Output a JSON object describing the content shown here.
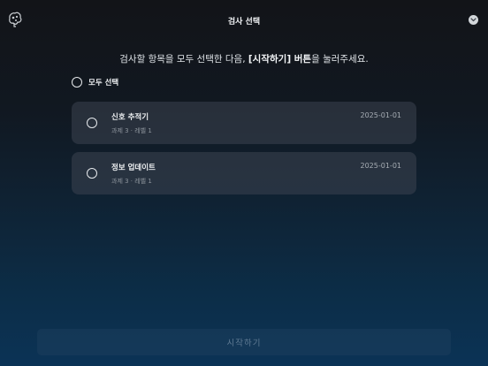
{
  "header": {
    "title": "검사 선택"
  },
  "instruction": {
    "prefix": "검사할 항목을 모두 선택한 다음, ",
    "highlight": "[시작하기] 버튼",
    "suffix": "을 눌러주세요."
  },
  "select_all": {
    "label": "모두 선택"
  },
  "tests": [
    {
      "title": "신호 추적기",
      "subtitle": "과제 3 · 레벨 1",
      "date": "2025-01-01"
    },
    {
      "title": "정보 업데이트",
      "subtitle": "과제 3 · 레벨 1",
      "date": "2025-01-01"
    }
  ],
  "start_button": {
    "label": "시작하기"
  },
  "icons": {
    "logo": "brain-logo-icon",
    "close": "chevron-down-icon",
    "radio": "radio-unchecked-icon"
  },
  "colors": {
    "background_top": "#121418",
    "background_bottom": "#0b3356",
    "card": "#2f3640",
    "start_button_text": "#5f7a93"
  }
}
